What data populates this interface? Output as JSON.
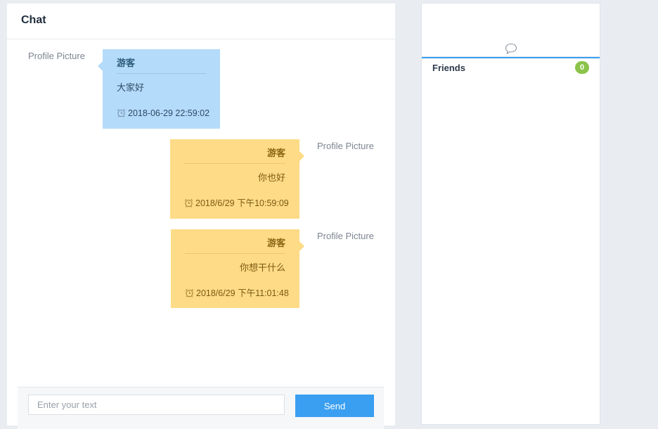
{
  "chat": {
    "title": "Chat",
    "avatar_label": "Profile Picture",
    "messages": [
      {
        "side": "left",
        "sender": "游客",
        "text": "大家好",
        "time": "2018-06-29 22:59:02"
      },
      {
        "side": "right",
        "sender": "游客",
        "text": "你也好",
        "time": "2018/6/29 下午10:59:09"
      },
      {
        "side": "right",
        "sender": "游客",
        "text": "你想干什么",
        "time": "2018/6/29 下午11:01:48"
      }
    ],
    "input": {
      "placeholder": "Enter your text",
      "value": ""
    },
    "send_label": "Send"
  },
  "friends": {
    "tab_label": "Friends",
    "count": "0",
    "icon": "chat-bubble-icon"
  },
  "colors": {
    "incoming_bubble": "#b5dbfb",
    "outgoing_bubble": "#fedb86",
    "accent": "#3a9ff0",
    "badge": "#8bc34a"
  }
}
